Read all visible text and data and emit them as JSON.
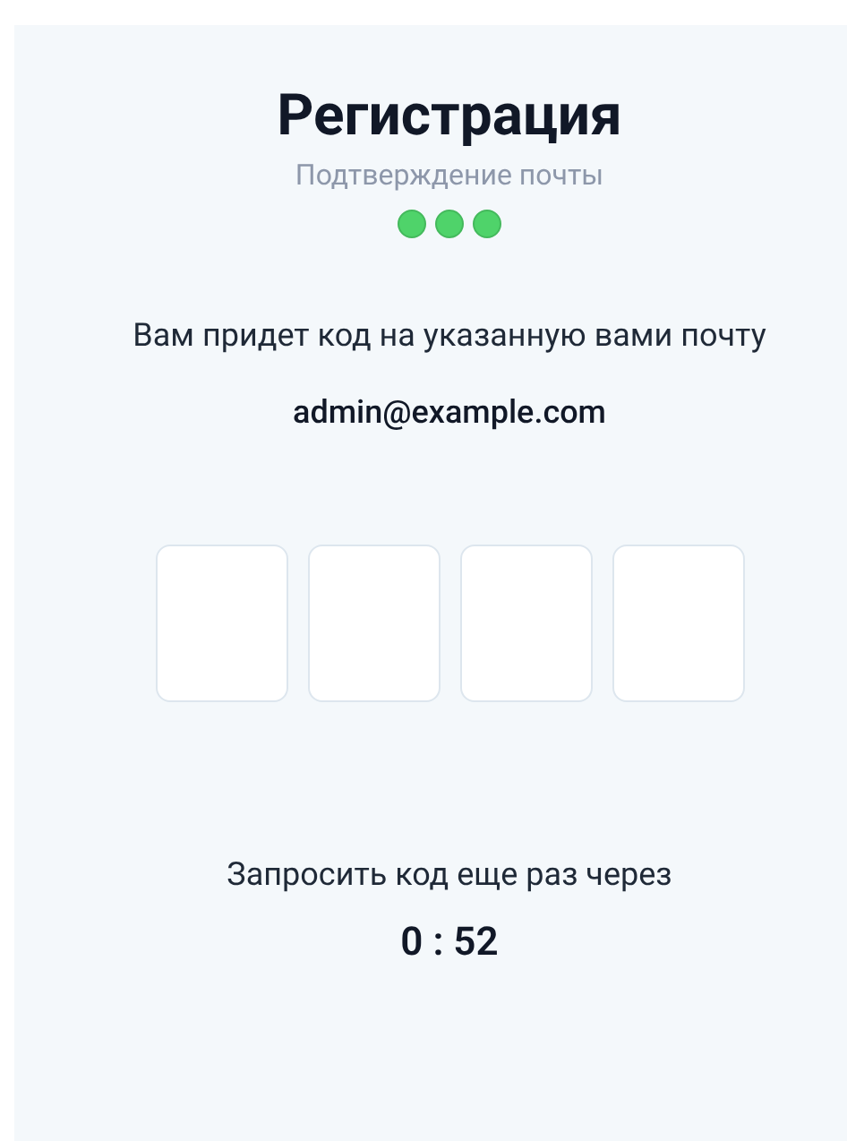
{
  "title": "Регистрация",
  "subtitle": "Подтверждение почты",
  "steps": [
    {
      "done": true
    },
    {
      "done": true
    },
    {
      "done": true
    }
  ],
  "message": "Вам придет код на указанную вами почту",
  "email": "admin@example.com",
  "code_fields": [
    {
      "filled": false
    },
    {
      "filled": false
    },
    {
      "filled": false
    },
    {
      "filled": false
    }
  ],
  "resend_label": "Запросить код еще раз через",
  "timer": "0 : 52"
}
